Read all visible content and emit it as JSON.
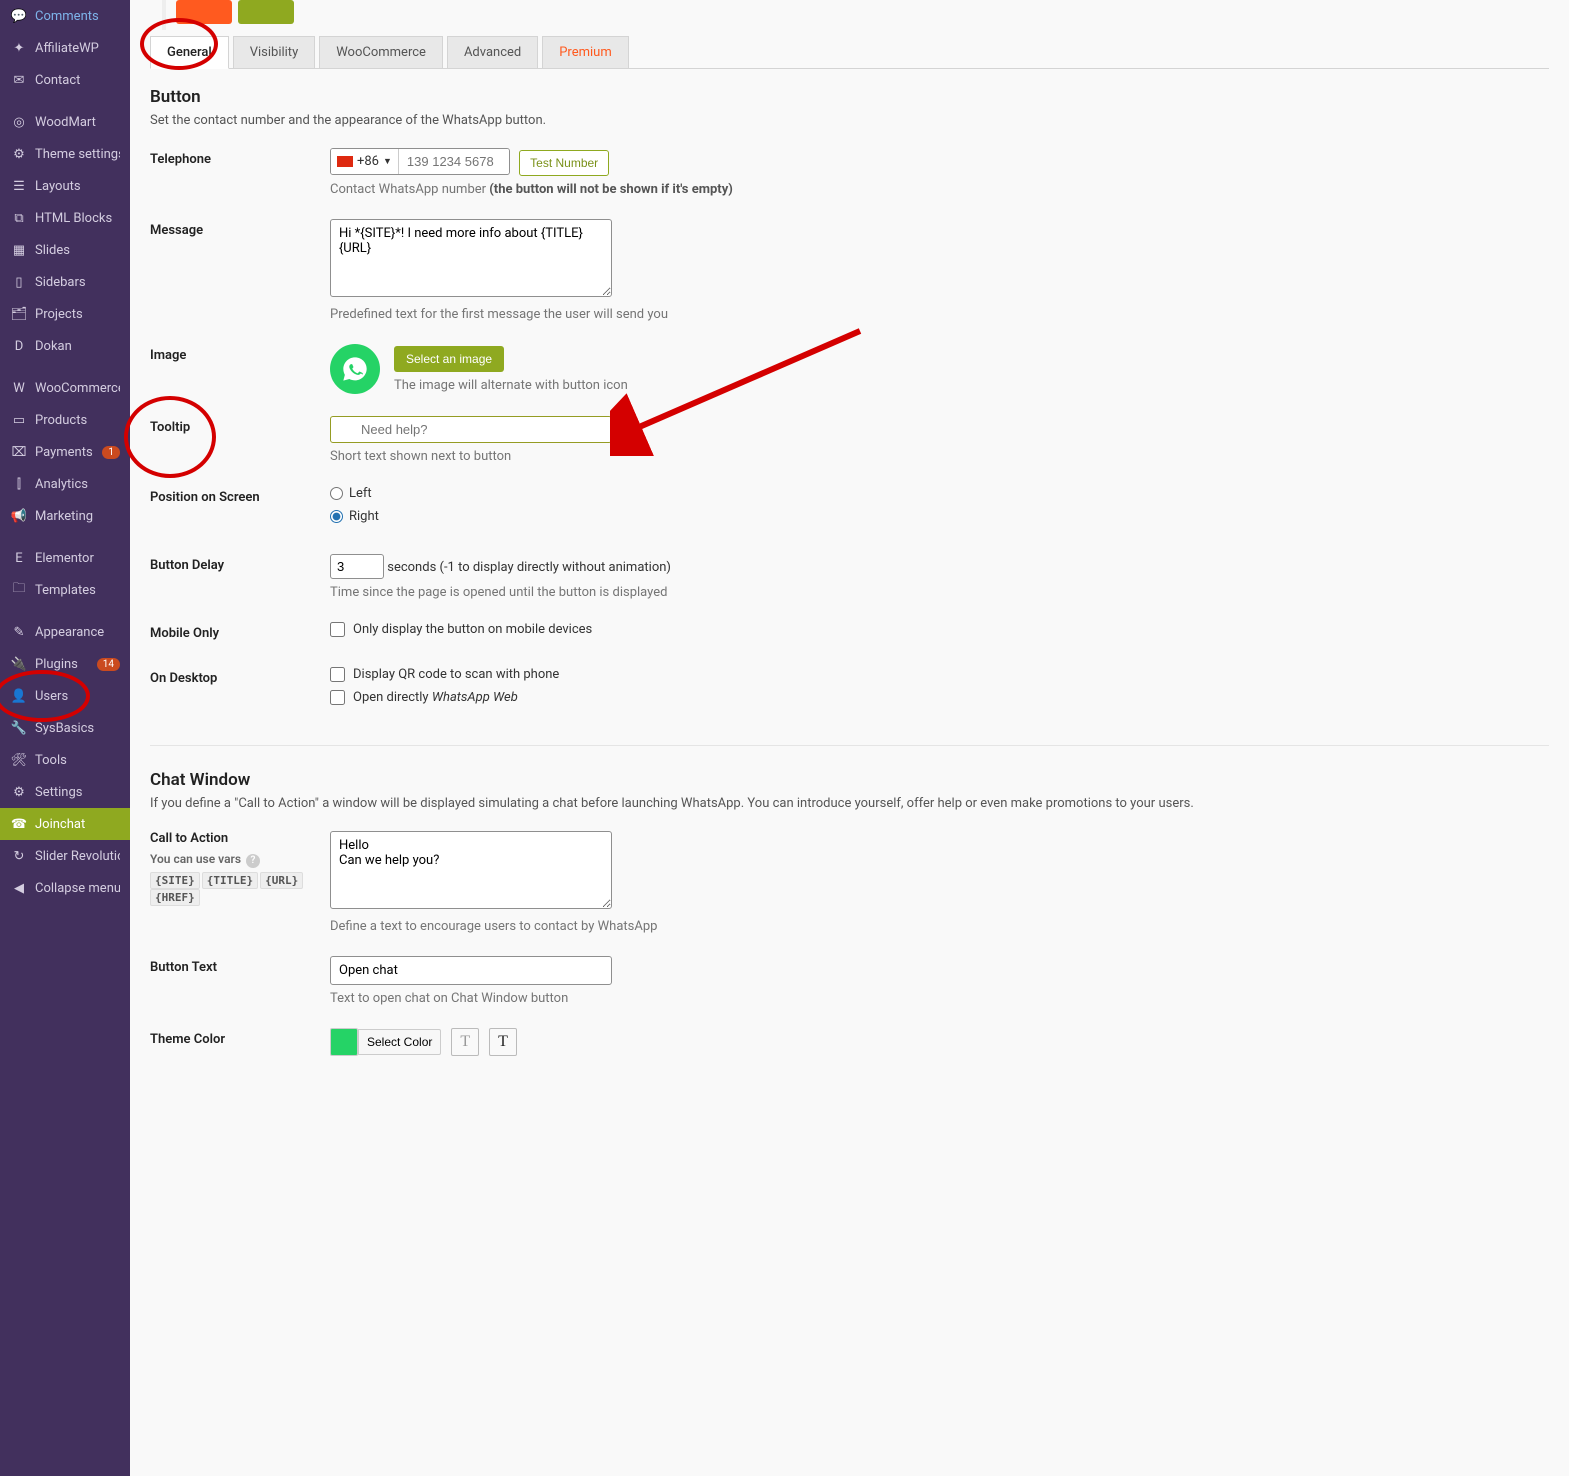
{
  "sidebar": {
    "items": [
      {
        "label": "Comments",
        "icon": "comment"
      },
      {
        "label": "AffiliateWP",
        "icon": "share"
      },
      {
        "label": "Contact",
        "icon": "mail"
      },
      {
        "sep": true
      },
      {
        "label": "WoodMart",
        "icon": "circle"
      },
      {
        "label": "Theme settings",
        "icon": "sliders"
      },
      {
        "label": "Layouts",
        "icon": "layers"
      },
      {
        "label": "HTML Blocks",
        "icon": "code"
      },
      {
        "label": "Slides",
        "icon": "slides"
      },
      {
        "label": "Sidebars",
        "icon": "columns"
      },
      {
        "label": "Projects",
        "icon": "briefcase"
      },
      {
        "label": "Dokan",
        "icon": "d"
      },
      {
        "sep": true
      },
      {
        "label": "WooCommerce",
        "icon": "woo"
      },
      {
        "label": "Products",
        "icon": "archive"
      },
      {
        "label": "Payments",
        "icon": "card",
        "badge": "1"
      },
      {
        "label": "Analytics",
        "icon": "chart"
      },
      {
        "label": "Marketing",
        "icon": "megaphone"
      },
      {
        "sep": true
      },
      {
        "label": "Elementor",
        "icon": "e"
      },
      {
        "label": "Templates",
        "icon": "folder"
      },
      {
        "sep": true
      },
      {
        "label": "Appearance",
        "icon": "brush"
      },
      {
        "label": "Plugins",
        "icon": "plug",
        "badge": "14"
      },
      {
        "label": "Users",
        "icon": "user"
      },
      {
        "label": "SysBasics",
        "icon": "wrench"
      },
      {
        "label": "Tools",
        "icon": "tools"
      },
      {
        "label": "Settings",
        "icon": "settings"
      },
      {
        "label": "Joinchat",
        "icon": "whatsapp",
        "active": true
      },
      {
        "label": "Slider Revolution",
        "icon": "refresh"
      },
      {
        "label": "Collapse menu",
        "icon": "collapse"
      }
    ]
  },
  "tabs": [
    "General",
    "Visibility",
    "WooCommerce",
    "Advanced",
    "Premium"
  ],
  "activeTab": "General",
  "button_section": {
    "title": "Button",
    "desc": "Set the contact number and the appearance of the WhatsApp button."
  },
  "fields": {
    "telephone": {
      "label": "Telephone",
      "cc": "+86",
      "placeholder": "139 1234 5678",
      "test": "Test Number",
      "help_prefix": "Contact WhatsApp number ",
      "help_strong": "(the button will not be shown if it's empty)"
    },
    "message": {
      "label": "Message",
      "value": "Hi *{SITE}*! I need more info about {TITLE} {URL}",
      "help": "Predefined text for the first message the user will send you"
    },
    "image": {
      "label": "Image",
      "button": "Select an image",
      "help": "The image will alternate with button icon"
    },
    "tooltip": {
      "label": "Tooltip",
      "placeholder": "Need help?",
      "help": "Short text shown next to button"
    },
    "position": {
      "label": "Position on Screen",
      "left": "Left",
      "right": "Right",
      "value": "right"
    },
    "delay": {
      "label": "Button Delay",
      "value": "3",
      "suffix": "seconds (-1 to display directly without animation)",
      "help": "Time since the page is opened until the button is displayed"
    },
    "mobile": {
      "label": "Mobile Only",
      "text": "Only display the button on mobile devices"
    },
    "desktop": {
      "label": "On Desktop",
      "qr": "Display QR code to scan with phone",
      "web_prefix": "Open directly ",
      "web_em": "WhatsApp Web"
    }
  },
  "chat_section": {
    "title": "Chat Window",
    "desc": "If you define a \"Call to Action\" a window will be displayed simulating a chat before launching WhatsApp. You can introduce yourself, offer help or even make promotions to your users."
  },
  "chat_fields": {
    "cta": {
      "label": "Call to Action",
      "vars_hint": "You can use vars",
      "chips": [
        "{SITE}",
        "{TITLE}",
        "{URL}",
        "{HREF}"
      ],
      "value": "Hello\nCan we help you?",
      "help": "Define a text to encourage users to contact by WhatsApp"
    },
    "btn_text": {
      "label": "Button Text",
      "value": "Open chat",
      "help": "Text to open chat on Chat Window button"
    },
    "theme": {
      "label": "Theme Color",
      "select": "Select Color"
    }
  }
}
